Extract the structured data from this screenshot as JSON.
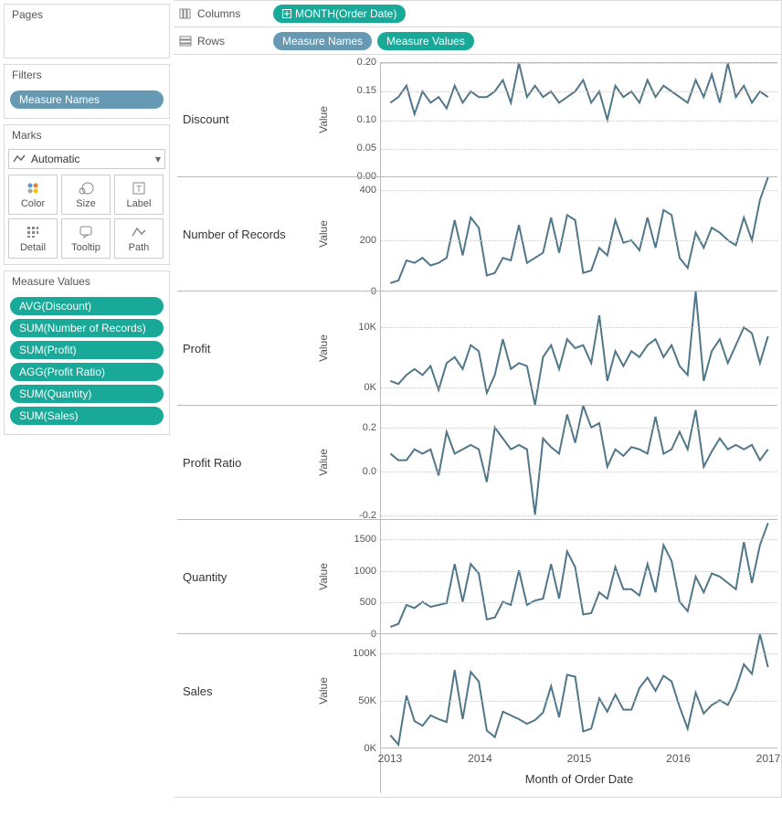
{
  "left": {
    "pages_title": "Pages",
    "filters_title": "Filters",
    "filters_pill": "Measure Names",
    "marks_title": "Marks",
    "marks_type": "Automatic",
    "mark_buttons": [
      {
        "name": "color",
        "label": "Color"
      },
      {
        "name": "size",
        "label": "Size"
      },
      {
        "name": "label",
        "label": "Label"
      },
      {
        "name": "detail",
        "label": "Detail"
      },
      {
        "name": "tooltip",
        "label": "Tooltip"
      },
      {
        "name": "path",
        "label": "Path"
      }
    ],
    "mv_title": "Measure Values",
    "mv_pills": [
      "AVG(Discount)",
      "SUM(Number of Records)",
      "SUM(Profit)",
      "AGG(Profit Ratio)",
      "SUM(Quantity)",
      "SUM(Sales)"
    ]
  },
  "shelves": {
    "columns_label": "Columns",
    "columns_pill": "MONTH(Order Date)",
    "rows_label": "Rows",
    "rows_pill_1": "Measure Names",
    "rows_pill_2": "Measure Values"
  },
  "axis": {
    "ylabel": "Value",
    "xlabel": "Month of Order Date",
    "xticks": [
      "2013",
      "2014",
      "2015",
      "2016",
      "2017"
    ]
  },
  "chart_data": [
    {
      "name": "Discount",
      "type": "line",
      "ylim": [
        0.0,
        0.2
      ],
      "yticks": [
        "0.20",
        "0.15",
        "0.10",
        "0.05",
        "0.00"
      ],
      "values": [
        0.13,
        0.14,
        0.16,
        0.11,
        0.15,
        0.13,
        0.14,
        0.12,
        0.16,
        0.13,
        0.15,
        0.14,
        0.14,
        0.15,
        0.17,
        0.13,
        0.2,
        0.14,
        0.16,
        0.14,
        0.15,
        0.13,
        0.14,
        0.15,
        0.17,
        0.13,
        0.15,
        0.1,
        0.16,
        0.14,
        0.15,
        0.13,
        0.17,
        0.14,
        0.16,
        0.15,
        0.14,
        0.13,
        0.17,
        0.14,
        0.18,
        0.13,
        0.2,
        0.14,
        0.16,
        0.13,
        0.15,
        0.14
      ]
    },
    {
      "name": "Number of Records",
      "type": "line",
      "ylim": [
        0,
        450
      ],
      "yticks": [
        "400",
        "200",
        "0"
      ],
      "values": [
        30,
        40,
        120,
        110,
        130,
        100,
        110,
        130,
        280,
        140,
        290,
        250,
        60,
        70,
        130,
        120,
        260,
        110,
        130,
        150,
        290,
        150,
        300,
        280,
        70,
        80,
        170,
        140,
        280,
        190,
        200,
        160,
        290,
        170,
        320,
        300,
        130,
        90,
        230,
        170,
        250,
        230,
        200,
        180,
        290,
        200,
        360,
        450
      ]
    },
    {
      "name": "Profit",
      "type": "line",
      "ylim": [
        -3000,
        16000
      ],
      "yticks": [
        "10K",
        "0K"
      ],
      "values": [
        1000,
        500,
        2000,
        3000,
        2000,
        3500,
        -500,
        4000,
        5000,
        3000,
        7000,
        6000,
        -1000,
        2000,
        8000,
        3000,
        4000,
        3500,
        -3000,
        5000,
        7000,
        3000,
        8000,
        6500,
        7000,
        4000,
        12000,
        1000,
        6000,
        3500,
        6000,
        5000,
        7000,
        8000,
        5000,
        7000,
        3500,
        2000,
        16000,
        1000,
        6000,
        8000,
        4000,
        7000,
        10000,
        9000,
        4000,
        8500
      ]
    },
    {
      "name": "Profit Ratio",
      "type": "line",
      "ylim": [
        -0.22,
        0.3
      ],
      "yticks": [
        "0.2",
        "0.0",
        "-0.2"
      ],
      "values": [
        0.08,
        0.05,
        0.05,
        0.1,
        0.08,
        0.1,
        -0.02,
        0.18,
        0.08,
        0.1,
        0.12,
        0.1,
        -0.05,
        0.2,
        0.15,
        0.1,
        0.12,
        0.1,
        -0.2,
        0.15,
        0.11,
        0.08,
        0.26,
        0.13,
        0.3,
        0.2,
        0.22,
        0.02,
        0.1,
        0.07,
        0.11,
        0.1,
        0.08,
        0.25,
        0.08,
        0.1,
        0.18,
        0.1,
        0.28,
        0.02,
        0.09,
        0.15,
        0.1,
        0.12,
        0.1,
        0.12,
        0.05,
        0.1
      ]
    },
    {
      "name": "Quantity",
      "type": "line",
      "ylim": [
        0,
        1800
      ],
      "yticks": [
        "1500",
        "1000",
        "500",
        "0"
      ],
      "values": [
        100,
        150,
        450,
        400,
        500,
        420,
        450,
        480,
        1100,
        500,
        1100,
        950,
        220,
        250,
        500,
        450,
        1000,
        450,
        520,
        550,
        1100,
        550,
        1300,
        1050,
        300,
        320,
        650,
        550,
        1050,
        700,
        700,
        600,
        1100,
        650,
        1400,
        1150,
        500,
        350,
        900,
        650,
        950,
        900,
        800,
        700,
        1450,
        800,
        1400,
        1750
      ]
    },
    {
      "name": "Sales",
      "type": "line",
      "ylim": [
        0,
        120000
      ],
      "yticks": [
        "100K",
        "50K",
        "0K"
      ],
      "values": [
        13000,
        3000,
        55000,
        28000,
        23000,
        34000,
        30000,
        27000,
        82000,
        30000,
        80000,
        70000,
        18000,
        11000,
        38000,
        34000,
        30000,
        25000,
        29000,
        37000,
        65000,
        32000,
        77000,
        75000,
        17000,
        20000,
        52000,
        38000,
        56000,
        40000,
        40000,
        63000,
        74000,
        60000,
        76000,
        70000,
        43000,
        20000,
        58000,
        36000,
        45000,
        50000,
        45000,
        62000,
        88000,
        78000,
        120000,
        85000
      ]
    }
  ]
}
